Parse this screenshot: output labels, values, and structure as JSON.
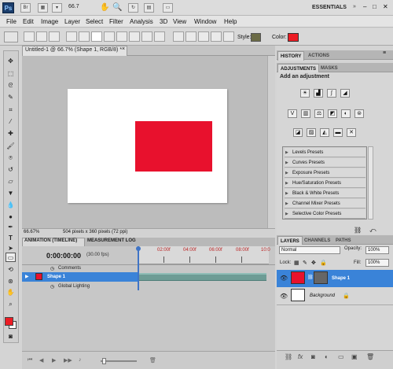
{
  "app": {
    "logo": "Ps",
    "zoom": "66.7",
    "workspace": "ESSENTIALS"
  },
  "menu": [
    "File",
    "Edit",
    "Image",
    "Layer",
    "Select",
    "Filter",
    "Analysis",
    "3D",
    "View",
    "Window",
    "Help"
  ],
  "options": {
    "style_label": "Style:",
    "color_label": "Color:",
    "shape_color": "#ec1c24"
  },
  "document": {
    "tab_title": "Untitled-1 @ 66.7% (Shape 1, RGB/8) *",
    "zoom": "66.67%",
    "info": "504 pixels x 360 pixels (72 ppi)",
    "shape_color": "#e8112d"
  },
  "timeline": {
    "tabs": [
      "ANIMATION (TIMELINE)",
      "MEASUREMENT LOG"
    ],
    "timecode": "0:00:00:00",
    "fps": "(30.00 fps)",
    "ticks": [
      "02:00f",
      "04:00f",
      "06:00f",
      "08:00f",
      "10:0"
    ],
    "rows": [
      {
        "label": "Comments"
      },
      {
        "label": "Shape 1"
      },
      {
        "label": "Global Lighting"
      }
    ]
  },
  "history_panel": {
    "tabs": [
      "HISTORY",
      "ACTIONS"
    ]
  },
  "adjustments": {
    "tabs": [
      "ADJUSTMENTS",
      "MASKS"
    ],
    "heading": "Add an adjustment",
    "presets": [
      "Levels Presets",
      "Curves Presets",
      "Exposure Presets",
      "Hue/Saturation Presets",
      "Black & White Presets",
      "Channel Mixer Presets",
      "Selective Color Presets"
    ]
  },
  "layers_panel": {
    "tabs": [
      "LAYERS",
      "CHANNELS",
      "PATHS"
    ],
    "blend_mode": "Normal",
    "opacity_label": "Opacity:",
    "opacity": "100%",
    "lock_label": "Lock:",
    "fill_label": "Fill:",
    "fill": "100%",
    "layers": [
      {
        "name": "Shape 1"
      },
      {
        "name": "Background"
      }
    ]
  }
}
